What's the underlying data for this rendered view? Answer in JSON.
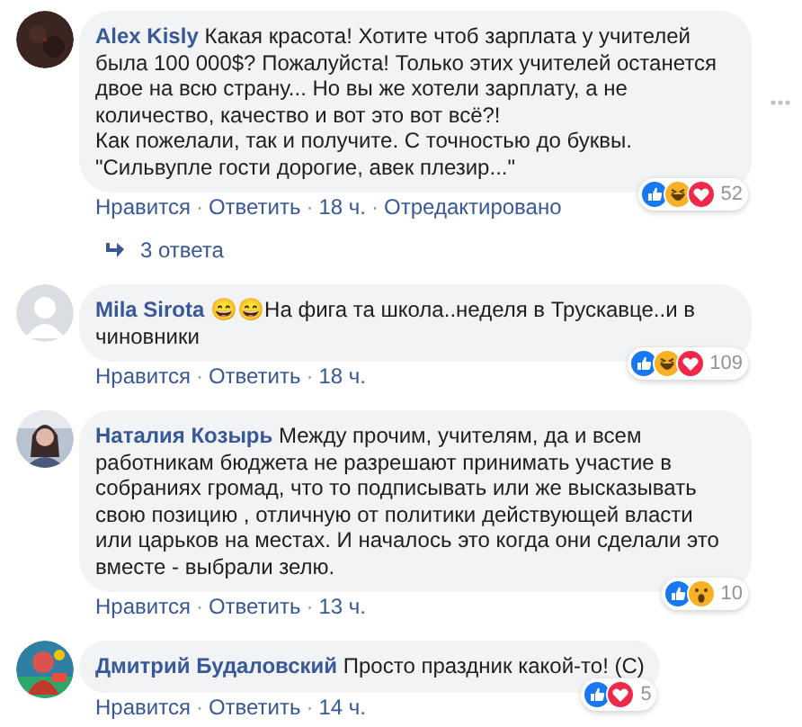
{
  "comments": [
    {
      "avatar": {
        "kind": "picture"
      },
      "author": "Alex Kisly",
      "text": "Какая красота! Хотите чтоб зарплата у учителей была 100 000$? Пожалуйста! Только этих учителей останется двое на всю страну... Но вы же хотели зарплату, а не количество, качество и вот это вот всё?!\nКак пожелали, так и получите. С точностью до буквы.\n\"Сильвупле гости дорогие, авек плезир...\"",
      "show_menu": true,
      "reactions": [
        {
          "kind": "like"
        },
        {
          "kind": "haha"
        },
        {
          "kind": "love"
        }
      ],
      "reaction_count": "52",
      "actions": [
        {
          "kind": "link",
          "text": "Нравится"
        },
        {
          "kind": "separator",
          "text": "·"
        },
        {
          "kind": "link",
          "text": "Ответить"
        },
        {
          "kind": "separator",
          "text": "·"
        },
        {
          "kind": "time",
          "text": "18 ч."
        },
        {
          "kind": "separator",
          "text": "·"
        },
        {
          "kind": "note",
          "text": "Отредактировано"
        }
      ],
      "replies": "3 ответа"
    },
    {
      "avatar": {
        "kind": "silhouette"
      },
      "author": "Mila Sirota",
      "text": "😄😄На фига та школа..неделя в Трускавце..и в чиновники",
      "show_menu": false,
      "reactions": [
        {
          "kind": "like"
        },
        {
          "kind": "haha"
        },
        {
          "kind": "love"
        }
      ],
      "reaction_count": "109",
      "actions": [
        {
          "kind": "link",
          "text": "Нравится"
        },
        {
          "kind": "separator",
          "text": "·"
        },
        {
          "kind": "link",
          "text": "Ответить"
        },
        {
          "kind": "separator",
          "text": "·"
        },
        {
          "kind": "time",
          "text": "18 ч."
        }
      ]
    },
    {
      "avatar": {
        "kind": "picture"
      },
      "author": "Наталия Козырь",
      "text": "Между прочим, учителям, да и всем работникам бюджета не разрешают принимать участие в собраниях громад, что то подписывать или же высказывать свою позицию , отличную от политики действующей власти или царьков на местах. И началось это когда они сделали это вместе - выбрали зелю.",
      "show_menu": false,
      "reactions": [
        {
          "kind": "like"
        },
        {
          "kind": "wow"
        }
      ],
      "reaction_count": "10",
      "actions": [
        {
          "kind": "link",
          "text": "Нравится"
        },
        {
          "kind": "separator",
          "text": "·"
        },
        {
          "kind": "link",
          "text": "Ответить"
        },
        {
          "kind": "separator",
          "text": "·"
        },
        {
          "kind": "time",
          "text": "13 ч."
        }
      ]
    },
    {
      "avatar": {
        "kind": "picture"
      },
      "author": "Дмитрий Будаловский",
      "text": "Просто праздник какой-то! (С)",
      "show_menu": false,
      "reactions": [
        {
          "kind": "like"
        },
        {
          "kind": "love"
        }
      ],
      "reaction_count": "5",
      "actions": [
        {
          "kind": "link",
          "text": "Нравится"
        },
        {
          "kind": "separator",
          "text": "·"
        },
        {
          "kind": "link",
          "text": "Ответить"
        },
        {
          "kind": "separator",
          "text": "·"
        },
        {
          "kind": "time",
          "text": "14 ч."
        }
      ]
    }
  ]
}
